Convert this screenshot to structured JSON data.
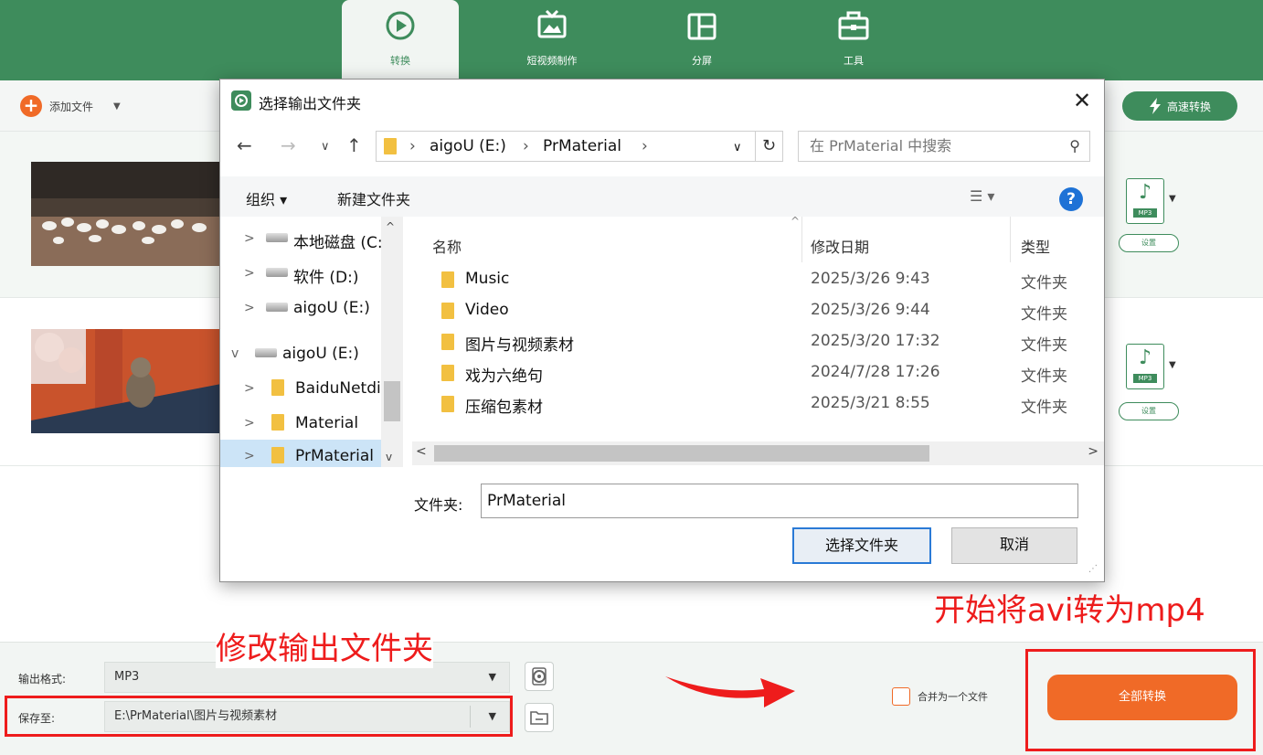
{
  "tabs": [
    {
      "label": "转换",
      "icon": "convert-icon",
      "active": true
    },
    {
      "label": "短视频制作",
      "icon": "tv-icon",
      "active": false
    },
    {
      "label": "分屏",
      "icon": "split-screen-icon",
      "active": false
    },
    {
      "label": "工具",
      "icon": "toolbox-icon",
      "active": false
    }
  ],
  "toolbar": {
    "add_file_label": "添加文件",
    "fast_convert_label": "高速转换"
  },
  "file_rows": [
    {
      "format": "MP3",
      "settings_label": "设置"
    },
    {
      "format": "MP3",
      "settings_label": "设置"
    }
  ],
  "bottom": {
    "output_format_label": "输出格式:",
    "output_format_value": "MP3",
    "save_to_label": "保存至:",
    "save_to_value": "E:\\PrMaterial\\图片与视频素材",
    "merge_label": "合并为一个文件",
    "convert_all_label": "全部转换"
  },
  "annotations": {
    "change_folder": "修改输出文件夹",
    "start_convert": "开始将avi转为mp4"
  },
  "dialog": {
    "title": "选择输出文件夹",
    "path": [
      "aigoU (E:)",
      "PrMaterial"
    ],
    "search_placeholder": "在 PrMaterial 中搜索",
    "organize_label": "组织 ▾",
    "new_folder_label": "新建文件夹",
    "tree": [
      {
        "label": "本地磁盘 (C:)",
        "type": "drive",
        "chevron": ">",
        "indent": 1
      },
      {
        "label": "软件 (D:)",
        "type": "drive",
        "chevron": ">",
        "indent": 1
      },
      {
        "label": "aigoU (E:)",
        "type": "drive",
        "chevron": ">",
        "indent": 1
      },
      {
        "label": "aigoU (E:)",
        "type": "drive",
        "chevron": "v",
        "indent": 0
      },
      {
        "label": "BaiduNetdisk",
        "type": "folder",
        "chevron": ">",
        "indent": 1
      },
      {
        "label": "Material",
        "type": "folder",
        "chevron": ">",
        "indent": 1
      },
      {
        "label": "PrMaterial",
        "type": "folder",
        "chevron": ">",
        "indent": 1,
        "selected": true
      }
    ],
    "columns": {
      "name": "名称",
      "date": "修改日期",
      "type": "类型"
    },
    "files": [
      {
        "name": "Music",
        "date": "2025/3/26 9:43",
        "type": "文件夹"
      },
      {
        "name": "Video",
        "date": "2025/3/26 9:44",
        "type": "文件夹"
      },
      {
        "name": "图片与视频素材",
        "date": "2025/3/20 17:32",
        "type": "文件夹"
      },
      {
        "name": "戏为六绝句",
        "date": "2024/7/28 17:26",
        "type": "文件夹"
      },
      {
        "name": "压缩包素材",
        "date": "2025/3/21 8:55",
        "type": "文件夹"
      }
    ],
    "folder_field_label": "文件夹:",
    "folder_field_value": "PrMaterial",
    "select_button": "选择文件夹",
    "cancel_button": "取消"
  },
  "colors": {
    "brand_green": "#3e8c5c",
    "accent_orange": "#f06a27",
    "annotation_red": "#ee1c1c"
  }
}
